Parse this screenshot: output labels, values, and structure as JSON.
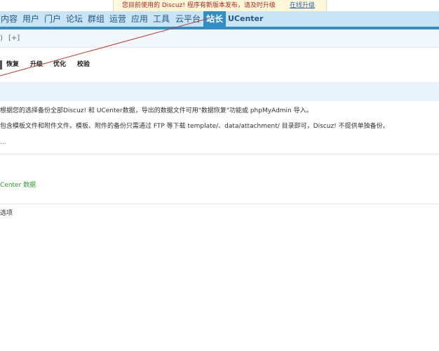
{
  "notice": {
    "message": "您目前使用的 Discuz! 程序有新版本发布，请及时升级",
    "link": "在线升级"
  },
  "nav": {
    "items": [
      "内容",
      "用户",
      "门户",
      "论坛",
      "群组",
      "运营",
      "应用",
      "工具",
      "云平台",
      "站长",
      "UCenter"
    ],
    "active": "站长"
  },
  "breadcrumb": {
    "prefix": ")",
    "add": "[+]"
  },
  "subnav": {
    "items": [
      "恢复",
      "升级",
      "优化",
      "校验"
    ]
  },
  "tips": {
    "line1": "根据您的选择备份全部Discuz! 和 UCenter数据，导出的数据文件可用\"数据恢复\"功能或 phpMyAdmin 导入。",
    "line2": "包含模板文件和附件文件。模板、附件的备份只需通过 FTP 等下载 template/、data/attachment/ 目录即可，Discuz! 不提供单独备份。",
    "ellipsis": "..."
  },
  "backup_option": "Center 数据",
  "more_options": "选项",
  "colors": {
    "nav_bg": "#c9e5f5",
    "nav_active": "#2f8fc6",
    "arrow": "#c0392b",
    "green_link": "#2c9a2c"
  }
}
